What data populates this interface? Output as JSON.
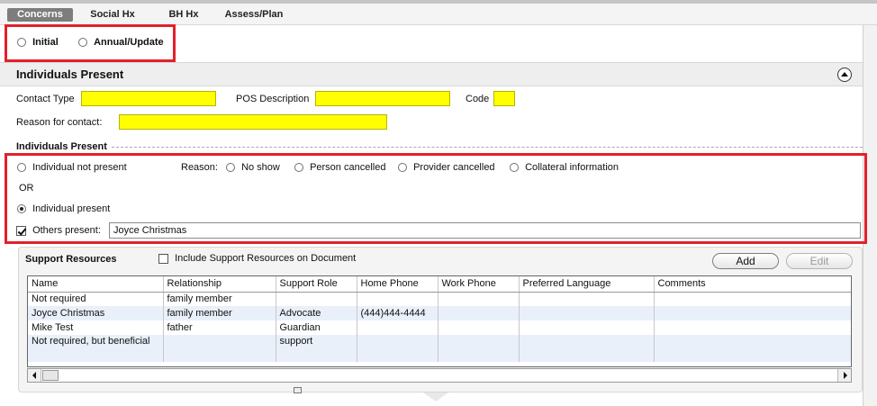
{
  "tabs": [
    "Concerns",
    "Social Hx",
    "BH Hx",
    "Assess/Plan"
  ],
  "assessment_type": {
    "options": [
      "Initial",
      "Annual/Update"
    ],
    "selected": null
  },
  "section": {
    "title": "Individuals Present",
    "collapse_icon": "chevron-up-circle-icon"
  },
  "contact": {
    "contact_type_label": "Contact Type",
    "contact_type_value": "",
    "pos_label": "POS Description",
    "pos_value": "",
    "code_label": "Code",
    "code_value": "",
    "reason_label": "Reason for contact:",
    "reason_value": "",
    "required_color": "#ffff00"
  },
  "individuals": {
    "group_label": "Individuals Present",
    "not_present_label": "Individual not present",
    "reason_label": "Reason:",
    "reasons": [
      "No show",
      "Person cancelled",
      "Provider cancelled",
      "Collateral information"
    ],
    "or_label": "OR",
    "present_label": "Individual present",
    "present_selected": true,
    "others_label": "Others present:",
    "others_checked": true,
    "others_value": "Joyce Christmas"
  },
  "support": {
    "title": "Support Resources",
    "include_label": "Include Support Resources on Document",
    "include_checked": false,
    "add_label": "Add",
    "edit_label": "Edit",
    "columns": [
      "Name",
      "Relationship",
      "Support Role",
      "Home Phone",
      "Work Phone",
      "Preferred Language",
      "Comments"
    ],
    "rows": [
      [
        " Not required",
        "family member",
        "",
        "",
        "",
        "",
        ""
      ],
      [
        "Joyce Christmas",
        "family member",
        "Advocate",
        "(444)444-4444",
        "",
        "",
        ""
      ],
      [
        "Mike Test",
        "father",
        "Guardian",
        "",
        "",
        "",
        ""
      ],
      [
        "Not required, but beneficial",
        "",
        "support",
        "",
        "",
        "",
        ""
      ]
    ]
  },
  "highlight_color": "#e3202b"
}
